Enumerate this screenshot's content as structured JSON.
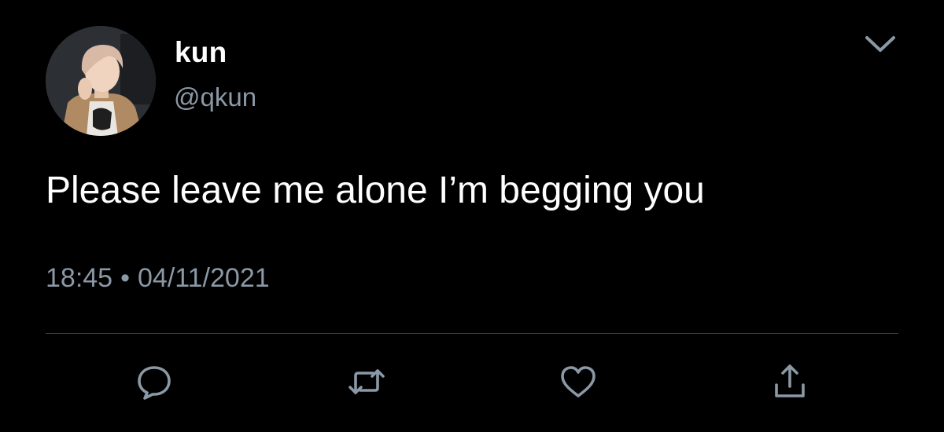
{
  "user": {
    "display_name": "kun",
    "handle": "@qkun",
    "avatar": "profile-photo"
  },
  "tweet": {
    "text": "Please leave me alone I’m begging you",
    "time": "18:45",
    "separator": "•",
    "date": "04/11/2021"
  },
  "actions": [
    {
      "name": "reply",
      "icon": "speech-bubble-icon"
    },
    {
      "name": "retweet",
      "icon": "retweet-arrows-icon"
    },
    {
      "name": "like",
      "icon": "heart-icon"
    },
    {
      "name": "share",
      "icon": "share-upload-icon"
    }
  ],
  "colors": {
    "background": "#000000",
    "text": "#ffffff",
    "secondary": "#8b98a5",
    "divider": "#3a3f44"
  }
}
